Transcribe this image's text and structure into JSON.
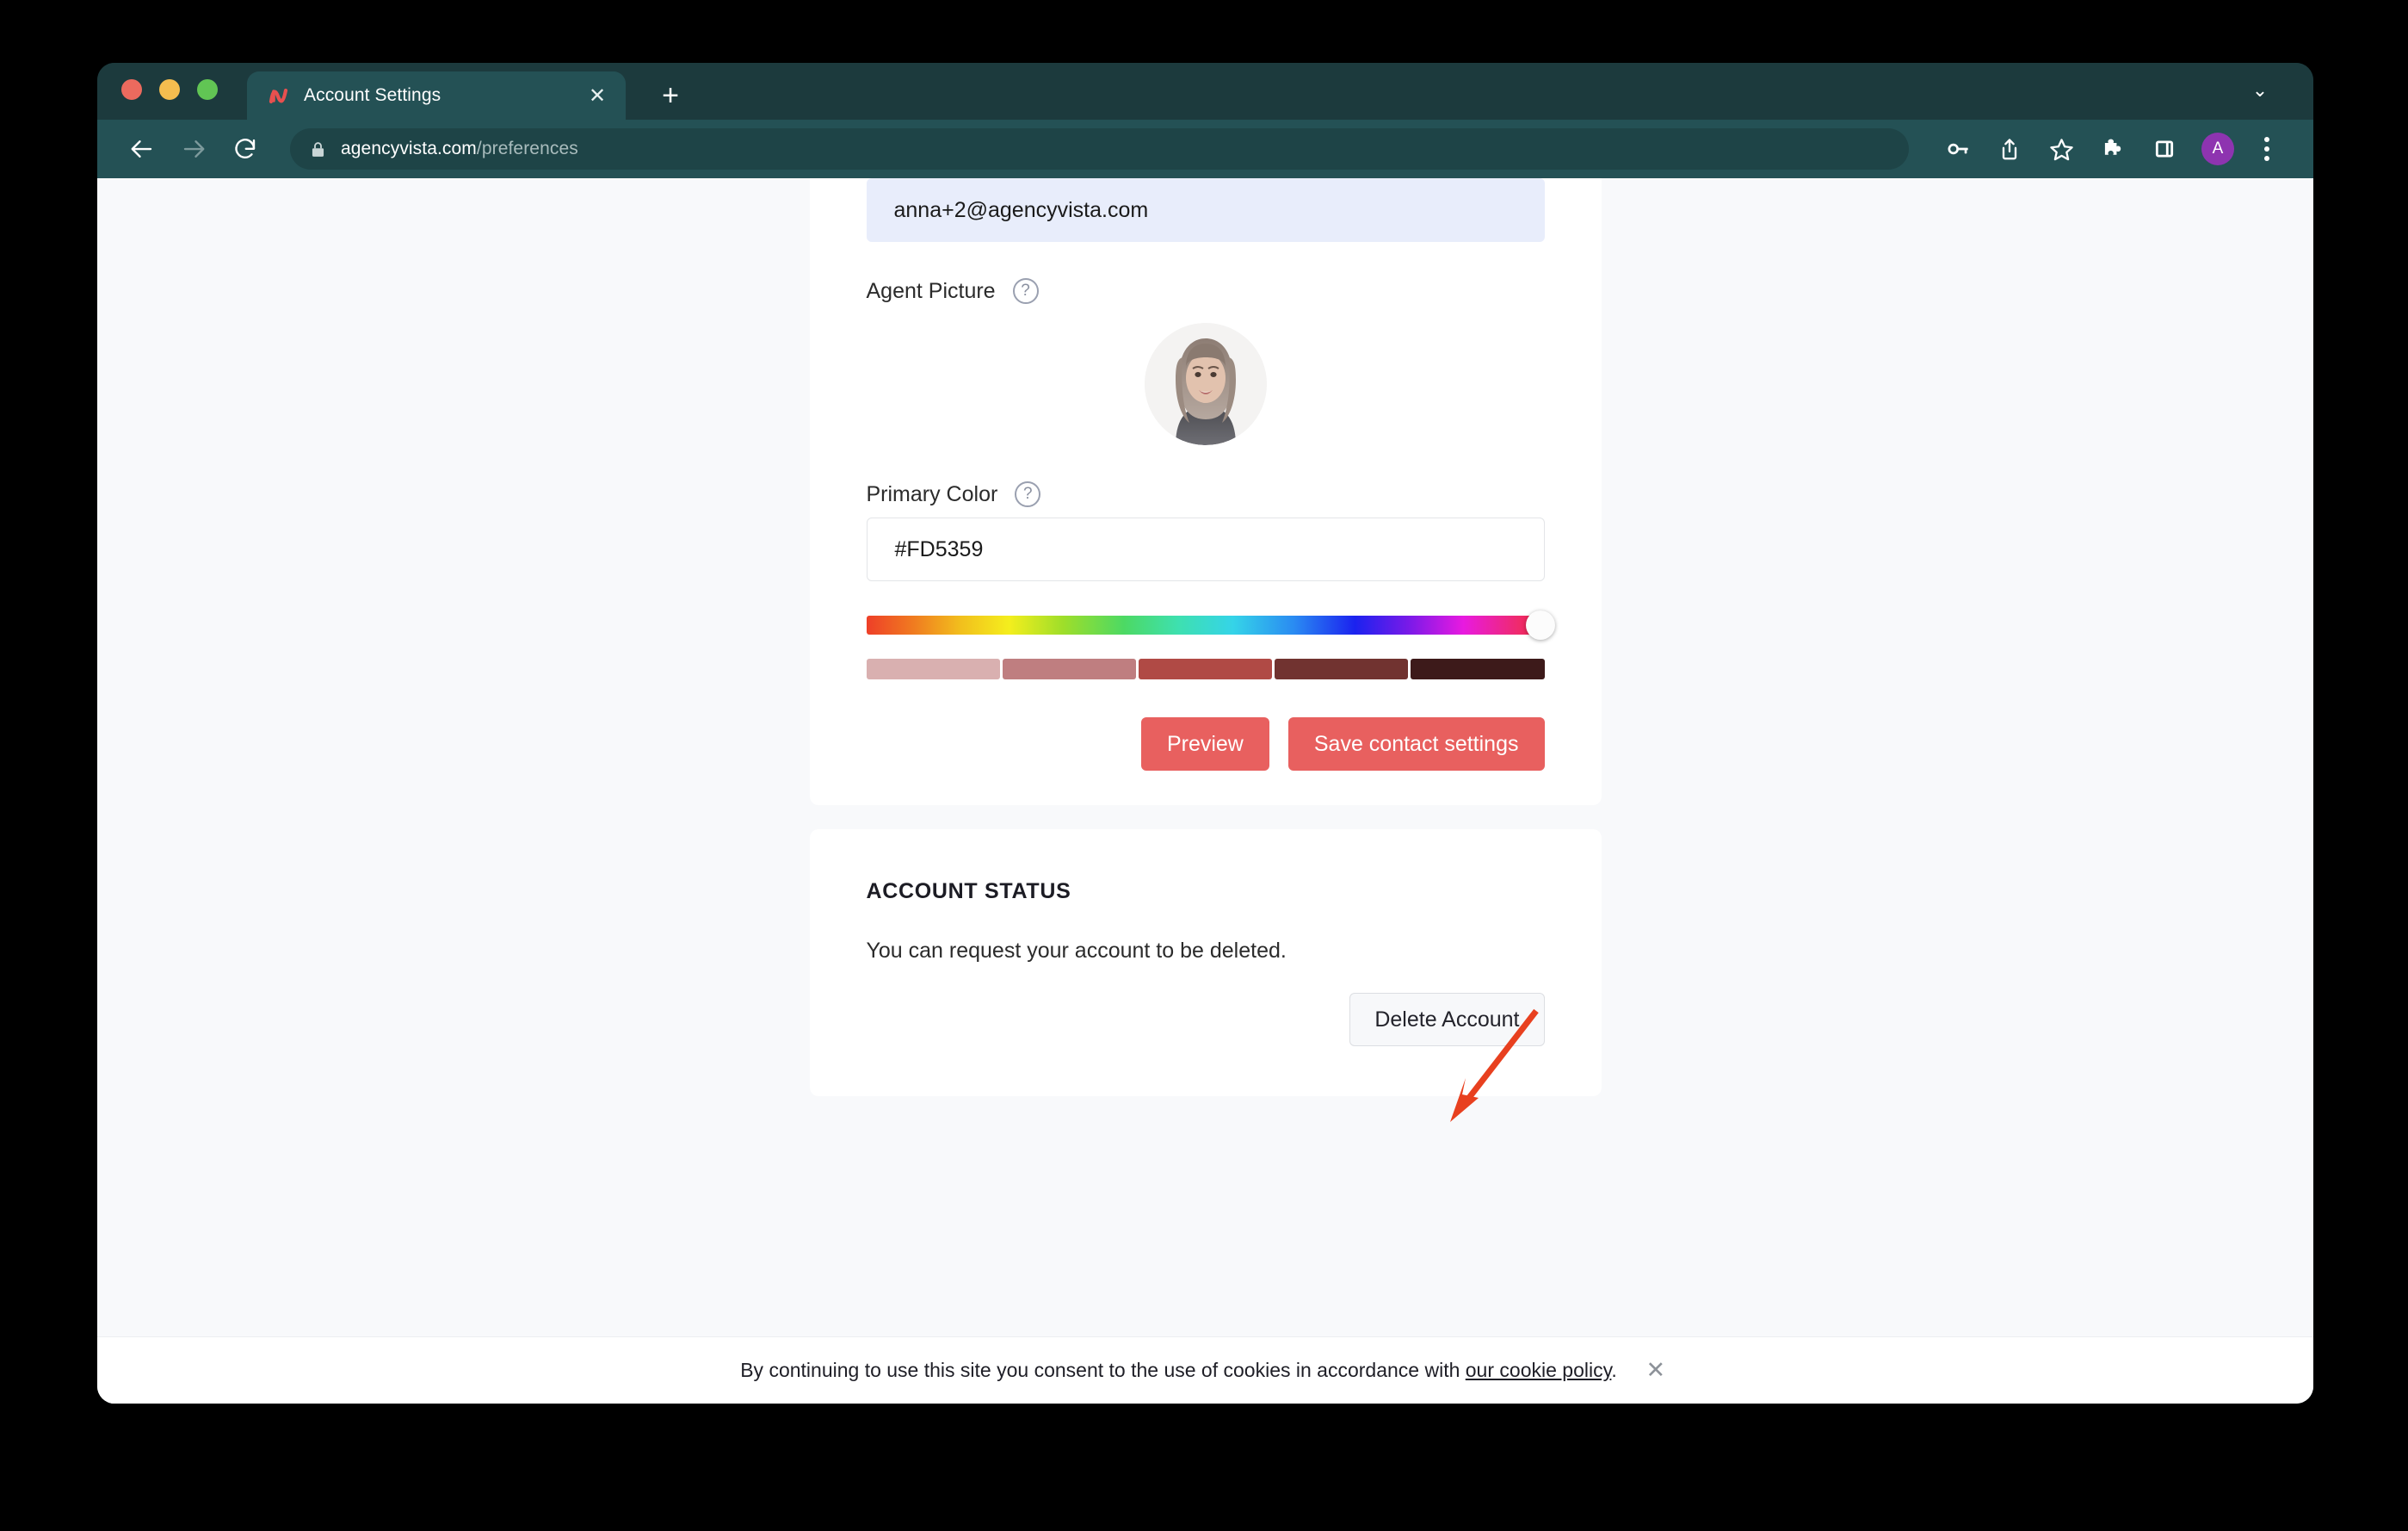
{
  "window": {
    "traffic_lights": [
      "close",
      "minimize",
      "maximize"
    ],
    "chevron": "⌄"
  },
  "tab": {
    "title": "Account Settings",
    "favicon": "agencyvista-logo-icon",
    "close_label": "✕",
    "new_tab_label": "+"
  },
  "toolbar": {
    "back_icon": "back-arrow-icon",
    "forward_icon": "forward-arrow-icon",
    "reload_icon": "reload-icon",
    "lock_icon": "lock-icon",
    "url_domain": "agencyvista.com",
    "url_path": "/preferences",
    "icons": [
      "key-icon",
      "share-icon",
      "star-icon",
      "puzzle-icon",
      "side-panel-icon"
    ],
    "profile_initial": "A",
    "profile_color": "#8e34b0",
    "menu_icon": "kebab-menu-icon"
  },
  "contact_card": {
    "email_value": "anna+2@agencyvista.com",
    "agent_picture_label": "Agent Picture",
    "agent_picture_help": "?",
    "primary_color_label": "Primary Color",
    "primary_color_help": "?",
    "primary_color_value": "#FD5359",
    "swatches": [
      "#d9b0b0",
      "#bf7e80",
      "#b04a45",
      "#713330",
      "#3d1a1a"
    ],
    "preview_label": "Preview",
    "save_label": "Save contact settings",
    "button_color": "#e8605f"
  },
  "status_card": {
    "title": "ACCOUNT STATUS",
    "description": "You can request your account to be deleted.",
    "delete_label": "Delete Account"
  },
  "annotation": {
    "arrow_color": "#e8401f",
    "points_to": "Delete Account"
  },
  "cookie_banner": {
    "text_before": "By continuing to use this site you consent to the use of cookies in accordance with",
    "link_text": "our cookie policy",
    "text_after": ".",
    "close_label": "✕"
  }
}
